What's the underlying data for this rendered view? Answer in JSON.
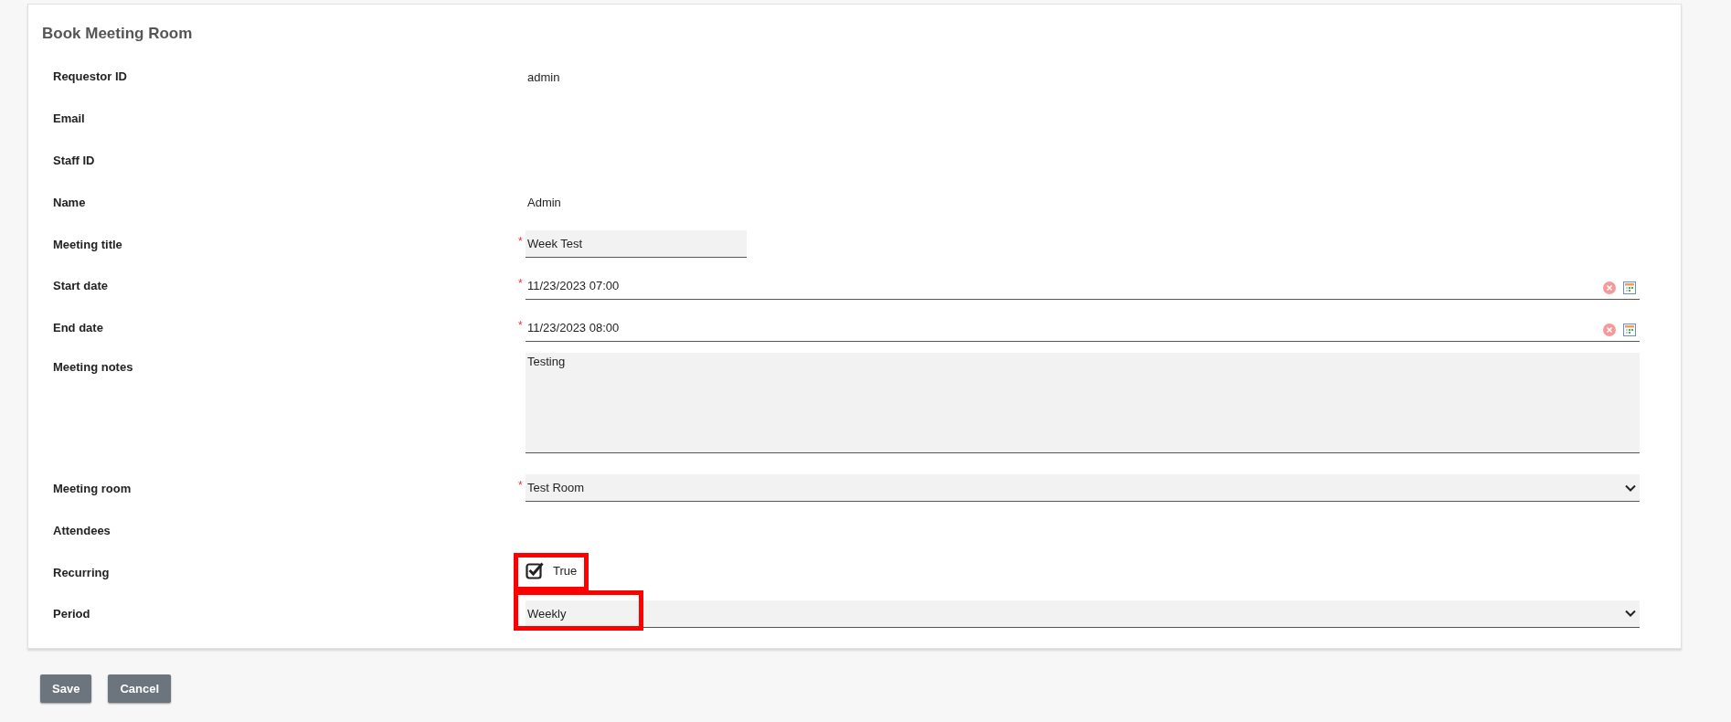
{
  "form": {
    "title": "Book Meeting Room",
    "fields": [
      {
        "label": "Requestor ID",
        "kind": "text",
        "value": "admin",
        "highlighted": false
      },
      {
        "label": "Email",
        "kind": "text",
        "highlighted": false
      },
      {
        "label": "Staff ID",
        "kind": "text",
        "highlighted": false
      },
      {
        "label": "Name",
        "kind": "text",
        "value": "Admin",
        "highlighted": false
      },
      {
        "label": "Meeting title",
        "kind": "input",
        "value": "Week Test",
        "required_mark": "*",
        "highlighted": false
      },
      {
        "label": "Start date",
        "kind": "date",
        "value": "11/23/2023 07:00",
        "required_mark": "*",
        "highlighted": false
      },
      {
        "label": "End date",
        "kind": "date",
        "value": "11/23/2023 08:00",
        "required_mark": "*",
        "highlighted": false
      },
      {
        "label": "Meeting notes",
        "kind": "textarea",
        "value": "Testing",
        "highlighted": false
      },
      {
        "label": "Meeting room",
        "kind": "select",
        "value": "Test Room",
        "required_mark": "*",
        "highlighted": false
      },
      {
        "label": "Attendees",
        "kind": "text",
        "highlighted": false
      },
      {
        "label": "Recurring",
        "kind": "checkbox",
        "value": "True",
        "checked": true,
        "highlighted": true
      },
      {
        "label": "Period",
        "kind": "select",
        "value": "Weekly",
        "highlighted": true
      }
    ]
  },
  "buttons": [
    "Save",
    "Cancel"
  ]
}
